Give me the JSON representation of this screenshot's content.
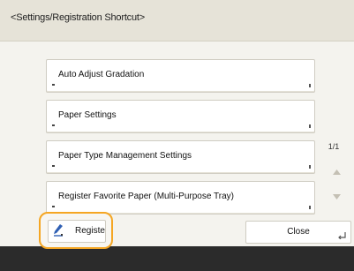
{
  "header": {
    "title": "<Settings/Registration Shortcut>"
  },
  "menu": {
    "items": [
      {
        "label": "Auto Adjust Gradation"
      },
      {
        "label": "Paper Settings"
      },
      {
        "label": "Paper Type Management Settings"
      },
      {
        "label": "Register Favorite Paper (Multi-Purpose Tray)"
      }
    ]
  },
  "pager": {
    "text": "1/1"
  },
  "footer": {
    "register_label": "Registe",
    "close_label": "Close"
  },
  "colors": {
    "highlight": "#f5a623",
    "header_bg": "#e6e3d8",
    "bottom_bar": "#2b2b2b",
    "pen_icon_blue": "#2f5fb3"
  },
  "icons": {
    "register": "pen-icon",
    "scroll_up": "triangle-up-icon",
    "scroll_down": "triangle-down-icon",
    "close": "return-corner-icon"
  }
}
